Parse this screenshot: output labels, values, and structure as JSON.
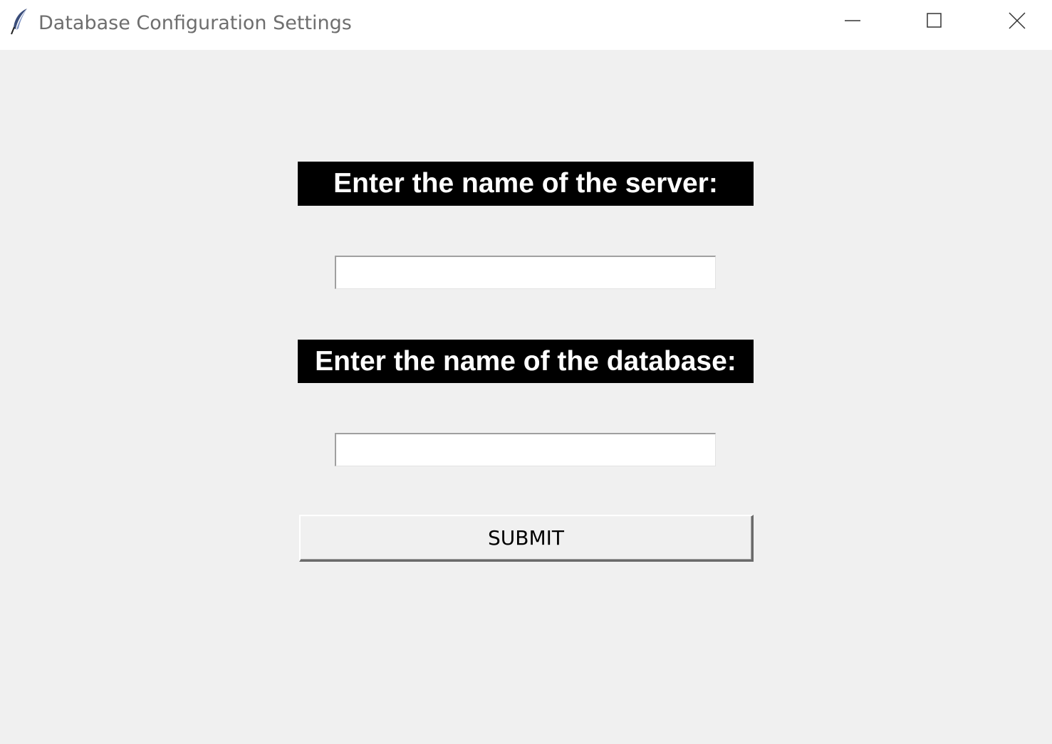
{
  "window": {
    "title": "Database Configuration Settings",
    "icon": "feather-icon",
    "controls": {
      "minimize_icon": "minimize-icon",
      "maximize_icon": "maximize-icon",
      "close_icon": "close-icon"
    }
  },
  "form": {
    "server_label": "Enter the name of the server:",
    "server_value": "",
    "database_label": "Enter the name of the database:",
    "database_value": "",
    "submit_label": "SUBMIT"
  },
  "colors": {
    "background": "#f0f0f0",
    "label_background": "#000000",
    "label_text": "#ffffff",
    "titlebar": "#ffffff"
  }
}
